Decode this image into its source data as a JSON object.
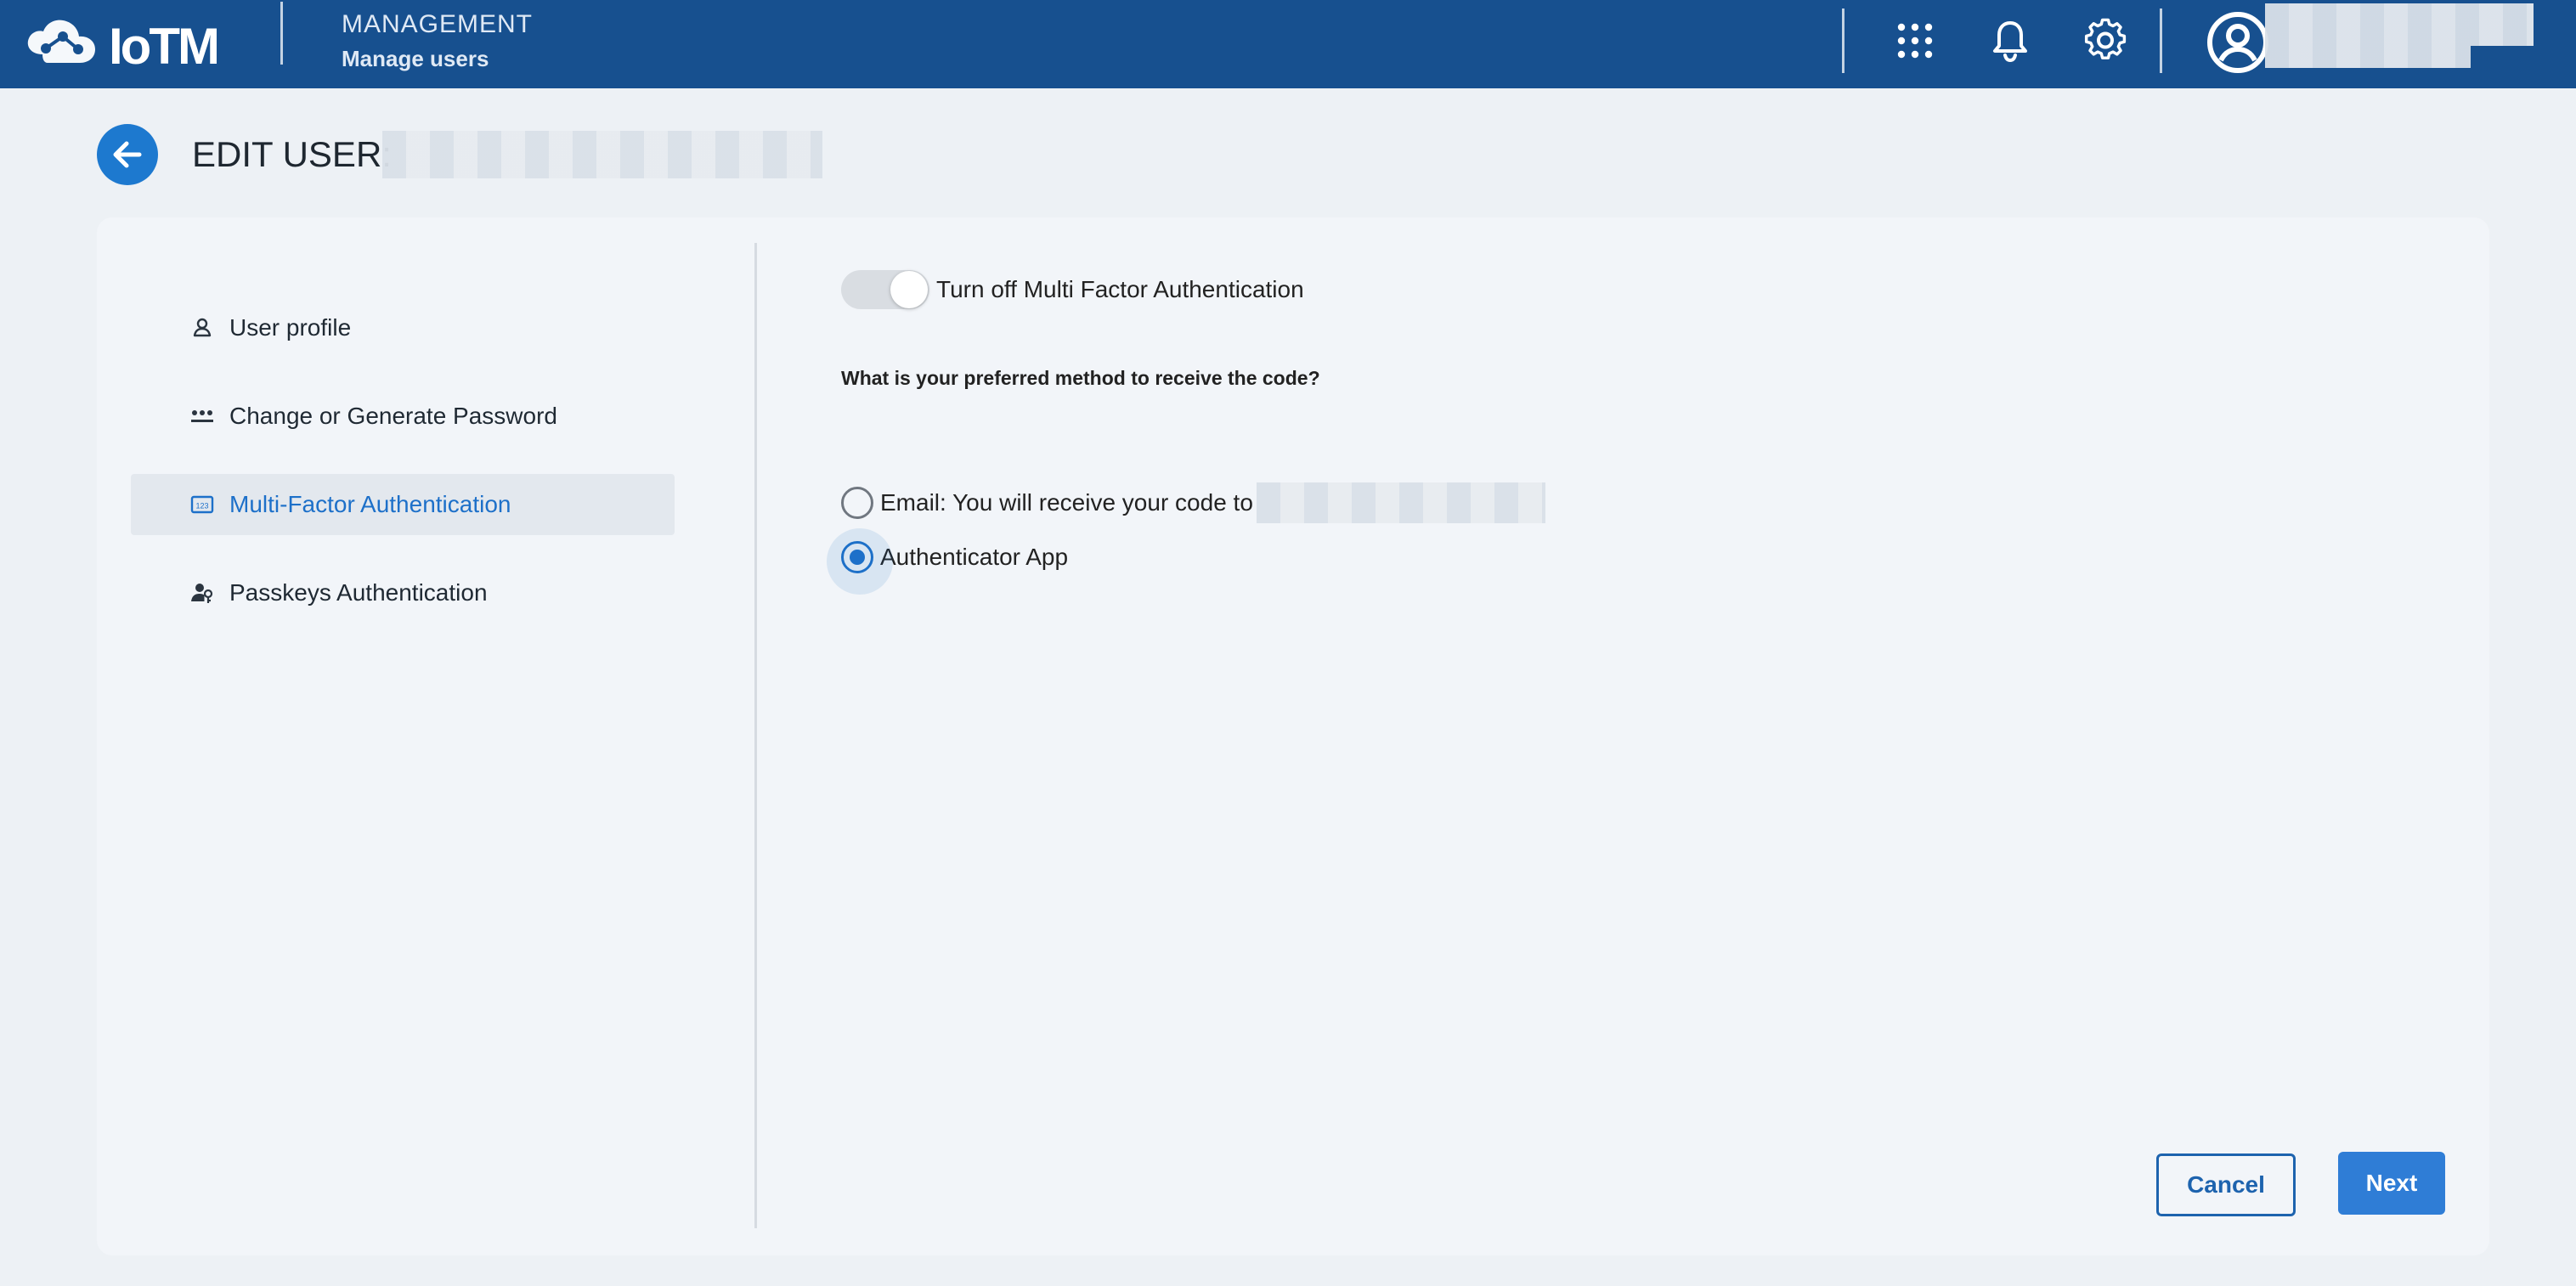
{
  "header": {
    "logo_text": "IoTM",
    "section_title": "MANAGEMENT",
    "section_subtitle": "Manage users",
    "icons": {
      "apps": "apps-grid-icon",
      "notifications": "bell-icon",
      "settings": "gear-icon",
      "account": "account-circle-icon"
    }
  },
  "page": {
    "back_icon": "arrow-left-icon",
    "edit_title": "EDIT USER:"
  },
  "sidebar": {
    "items": [
      {
        "label": "User profile",
        "icon": "person-icon",
        "active": false
      },
      {
        "label": "Change or Generate Password",
        "icon": "password-dots-icon",
        "active": false
      },
      {
        "label": "Multi-Factor Authentication",
        "icon": "pin-code-icon",
        "active": true
      },
      {
        "label": "Passkeys Authentication",
        "icon": "person-key-icon",
        "active": false
      }
    ]
  },
  "mfa": {
    "toggle_label": "Turn off Multi Factor Authentication",
    "question": "What is your preferred method to receive the code?",
    "options": [
      {
        "label": "Email: You will receive your code to",
        "selected": false
      },
      {
        "label": "Authenticator App",
        "selected": true
      }
    ]
  },
  "actions": {
    "cancel_label": "Cancel",
    "next_label": "Next"
  },
  "colors": {
    "header_bg": "#17508f",
    "accent": "#1d70c9",
    "primary_button": "#2f7dd6",
    "page_bg": "#edf1f5"
  }
}
